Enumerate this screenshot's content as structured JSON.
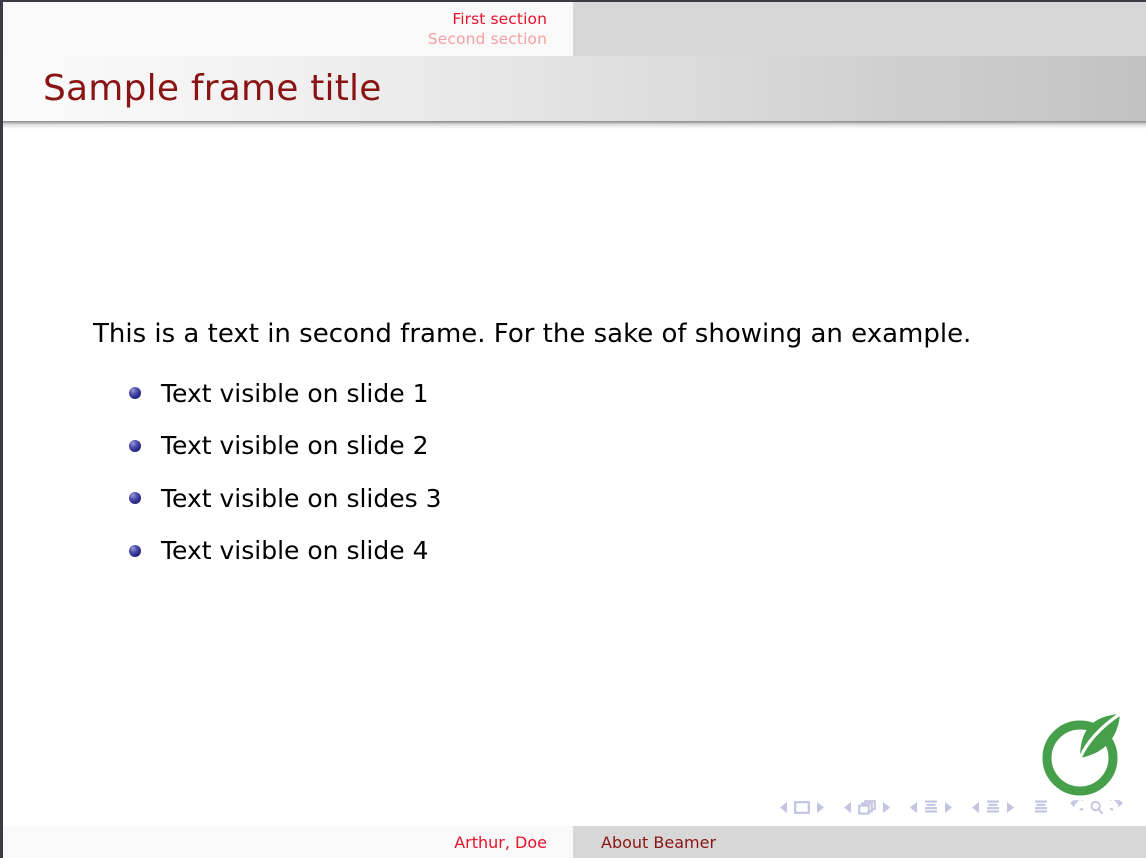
{
  "slide": {
    "frame_title": "Sample frame title",
    "background_color": "#ffffff"
  },
  "headline": {
    "sections": [
      {
        "label": "First section",
        "state": "active",
        "color": "#e8122a"
      },
      {
        "label": "Second section",
        "state": "inactive",
        "color": "#f4a0a4"
      }
    ]
  },
  "content": {
    "intro": "This is a text in second frame.  For the sake of showing an example.",
    "bullets": [
      {
        "label": "Text visible on slide 1"
      },
      {
        "label": "Text visible on slide 2"
      },
      {
        "label": "Text visible on slides 3"
      },
      {
        "label": "Text visible on slide 4"
      }
    ],
    "bullet_color": "#2a2a8c"
  },
  "logo": {
    "name": "overleaf-logo",
    "color": "#46a04b"
  },
  "navigation_symbols": {
    "color": "#c3c3e2",
    "groups": [
      {
        "name": "slide-navigation",
        "items": [
          "prev-slide-icon",
          "slide-icon",
          "next-slide-icon"
        ]
      },
      {
        "name": "frame-navigation",
        "items": [
          "prev-frame-icon",
          "frame-icon",
          "next-frame-icon"
        ]
      },
      {
        "name": "subsection-navigation",
        "items": [
          "prev-subsection-icon",
          "subsection-icon",
          "next-subsection-icon"
        ]
      },
      {
        "name": "section-navigation",
        "items": [
          "prev-section-icon",
          "section-icon",
          "next-section-icon"
        ]
      },
      {
        "name": "presentation-navigation",
        "items": [
          "presentation-icon"
        ]
      },
      {
        "name": "history-navigation",
        "items": [
          "back-icon",
          "search-icon",
          "forward-icon"
        ]
      }
    ]
  },
  "footline": {
    "author": "Arthur, Doe",
    "title": "About Beamer",
    "author_color": "#e8122a",
    "title_color": "#8a1414"
  }
}
